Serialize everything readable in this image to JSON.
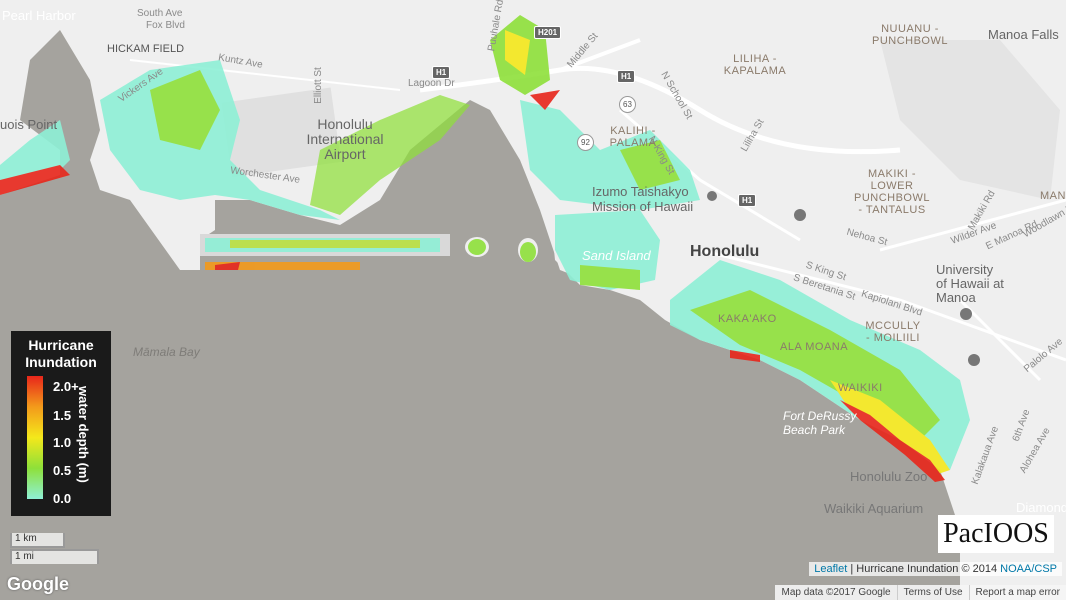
{
  "map": {
    "labels": {
      "pearl_harbor": "Pearl Harbor",
      "hickam_field": "HICKAM FIELD",
      "ewa_point": "uois Point",
      "airport": "Honolulu International Airport",
      "mamala_bay": "Māmala Bay",
      "sand_island": "Sand Island",
      "izumo": "Izumo Taishakyo Mission of Hawaii",
      "honolulu": "Honolulu",
      "kakaako": "KAKA'AKO",
      "ala_moana": "ALA MOANA",
      "waikiki": "WAIKIKI",
      "mccully": "MCCULLY - MOILIILI",
      "fort_derussy": "Fort DeRussy Beach Park",
      "honolulu_zoo": "Honolulu Zoo",
      "waikiki_aquarium": "Waikiki Aquarium",
      "diamond": "Diamond",
      "kalihi": "KALIHI - PALAMA",
      "liliha": "LILIHA - KAPALAMA",
      "nuuanu": "NUUANU - PUNCHBOWL",
      "makiki": "MAKIKI - LOWER PUNCHBOWL - TANTALUS",
      "manoa_falls": "Manoa Falls",
      "univ_hawaii": "University of Hawaii at Manoa",
      "manoa": "MANOA"
    },
    "roads": {
      "south_ave": "South Ave",
      "fox_blvd": "Fox Blvd",
      "kuntz": "Kuntz Ave",
      "vickers": "Vickers Ave",
      "elliott": "Elliott St",
      "lagoon": "Lagoon Dr",
      "worchester": "Worchester Ave",
      "middle": "Middle St",
      "n_school": "N School St",
      "n_king": "N King St",
      "liliha_st": "Liliha St",
      "nehoa": "Nehoa St",
      "wilder": "Wilder Ave",
      "e_manoa": "E Manoa Rd",
      "kapiolani": "Kapiolani Blvd",
      "s_beretania": "S Beretania St",
      "s_king": "S King St",
      "kalakaua": "Kalakaua Ave",
      "alohea": "Alohea Ave",
      "palolo": "Palolo Ave",
      "sixth": "6th Ave",
      "makiki_rd": "Makiki Rd",
      "woodlawn": "Woodlawn Dr",
      "puuhale": "Puuhale Rd"
    },
    "shields": {
      "h1a": "H1",
      "h1b": "H1",
      "h1c": "H1",
      "h201": "H201",
      "r63": "63",
      "r92": "92"
    }
  },
  "legend": {
    "title": "Hurricane Inundation",
    "ticks": [
      "2.0+",
      "1.5",
      "1.0",
      "0.5",
      "0.0"
    ],
    "axis_label": "water depth (m)",
    "colors": [
      "#e8261b",
      "#f39a1b",
      "#f4e81b",
      "#8ee03a",
      "#8ef0d6"
    ]
  },
  "scale": {
    "km": "1 km",
    "mi": "1 mi"
  },
  "google_logo": "Google",
  "pacioos_logo": "PacIOOS",
  "attribution": {
    "leaflet": "Leaflet",
    "separator": "|",
    "text": "Hurricane Inundation © 2014",
    "source": "NOAA/CSP"
  },
  "footer": {
    "map_data": "Map data ©2017 Google",
    "terms": "Terms of Use",
    "report": "Report a map error"
  }
}
